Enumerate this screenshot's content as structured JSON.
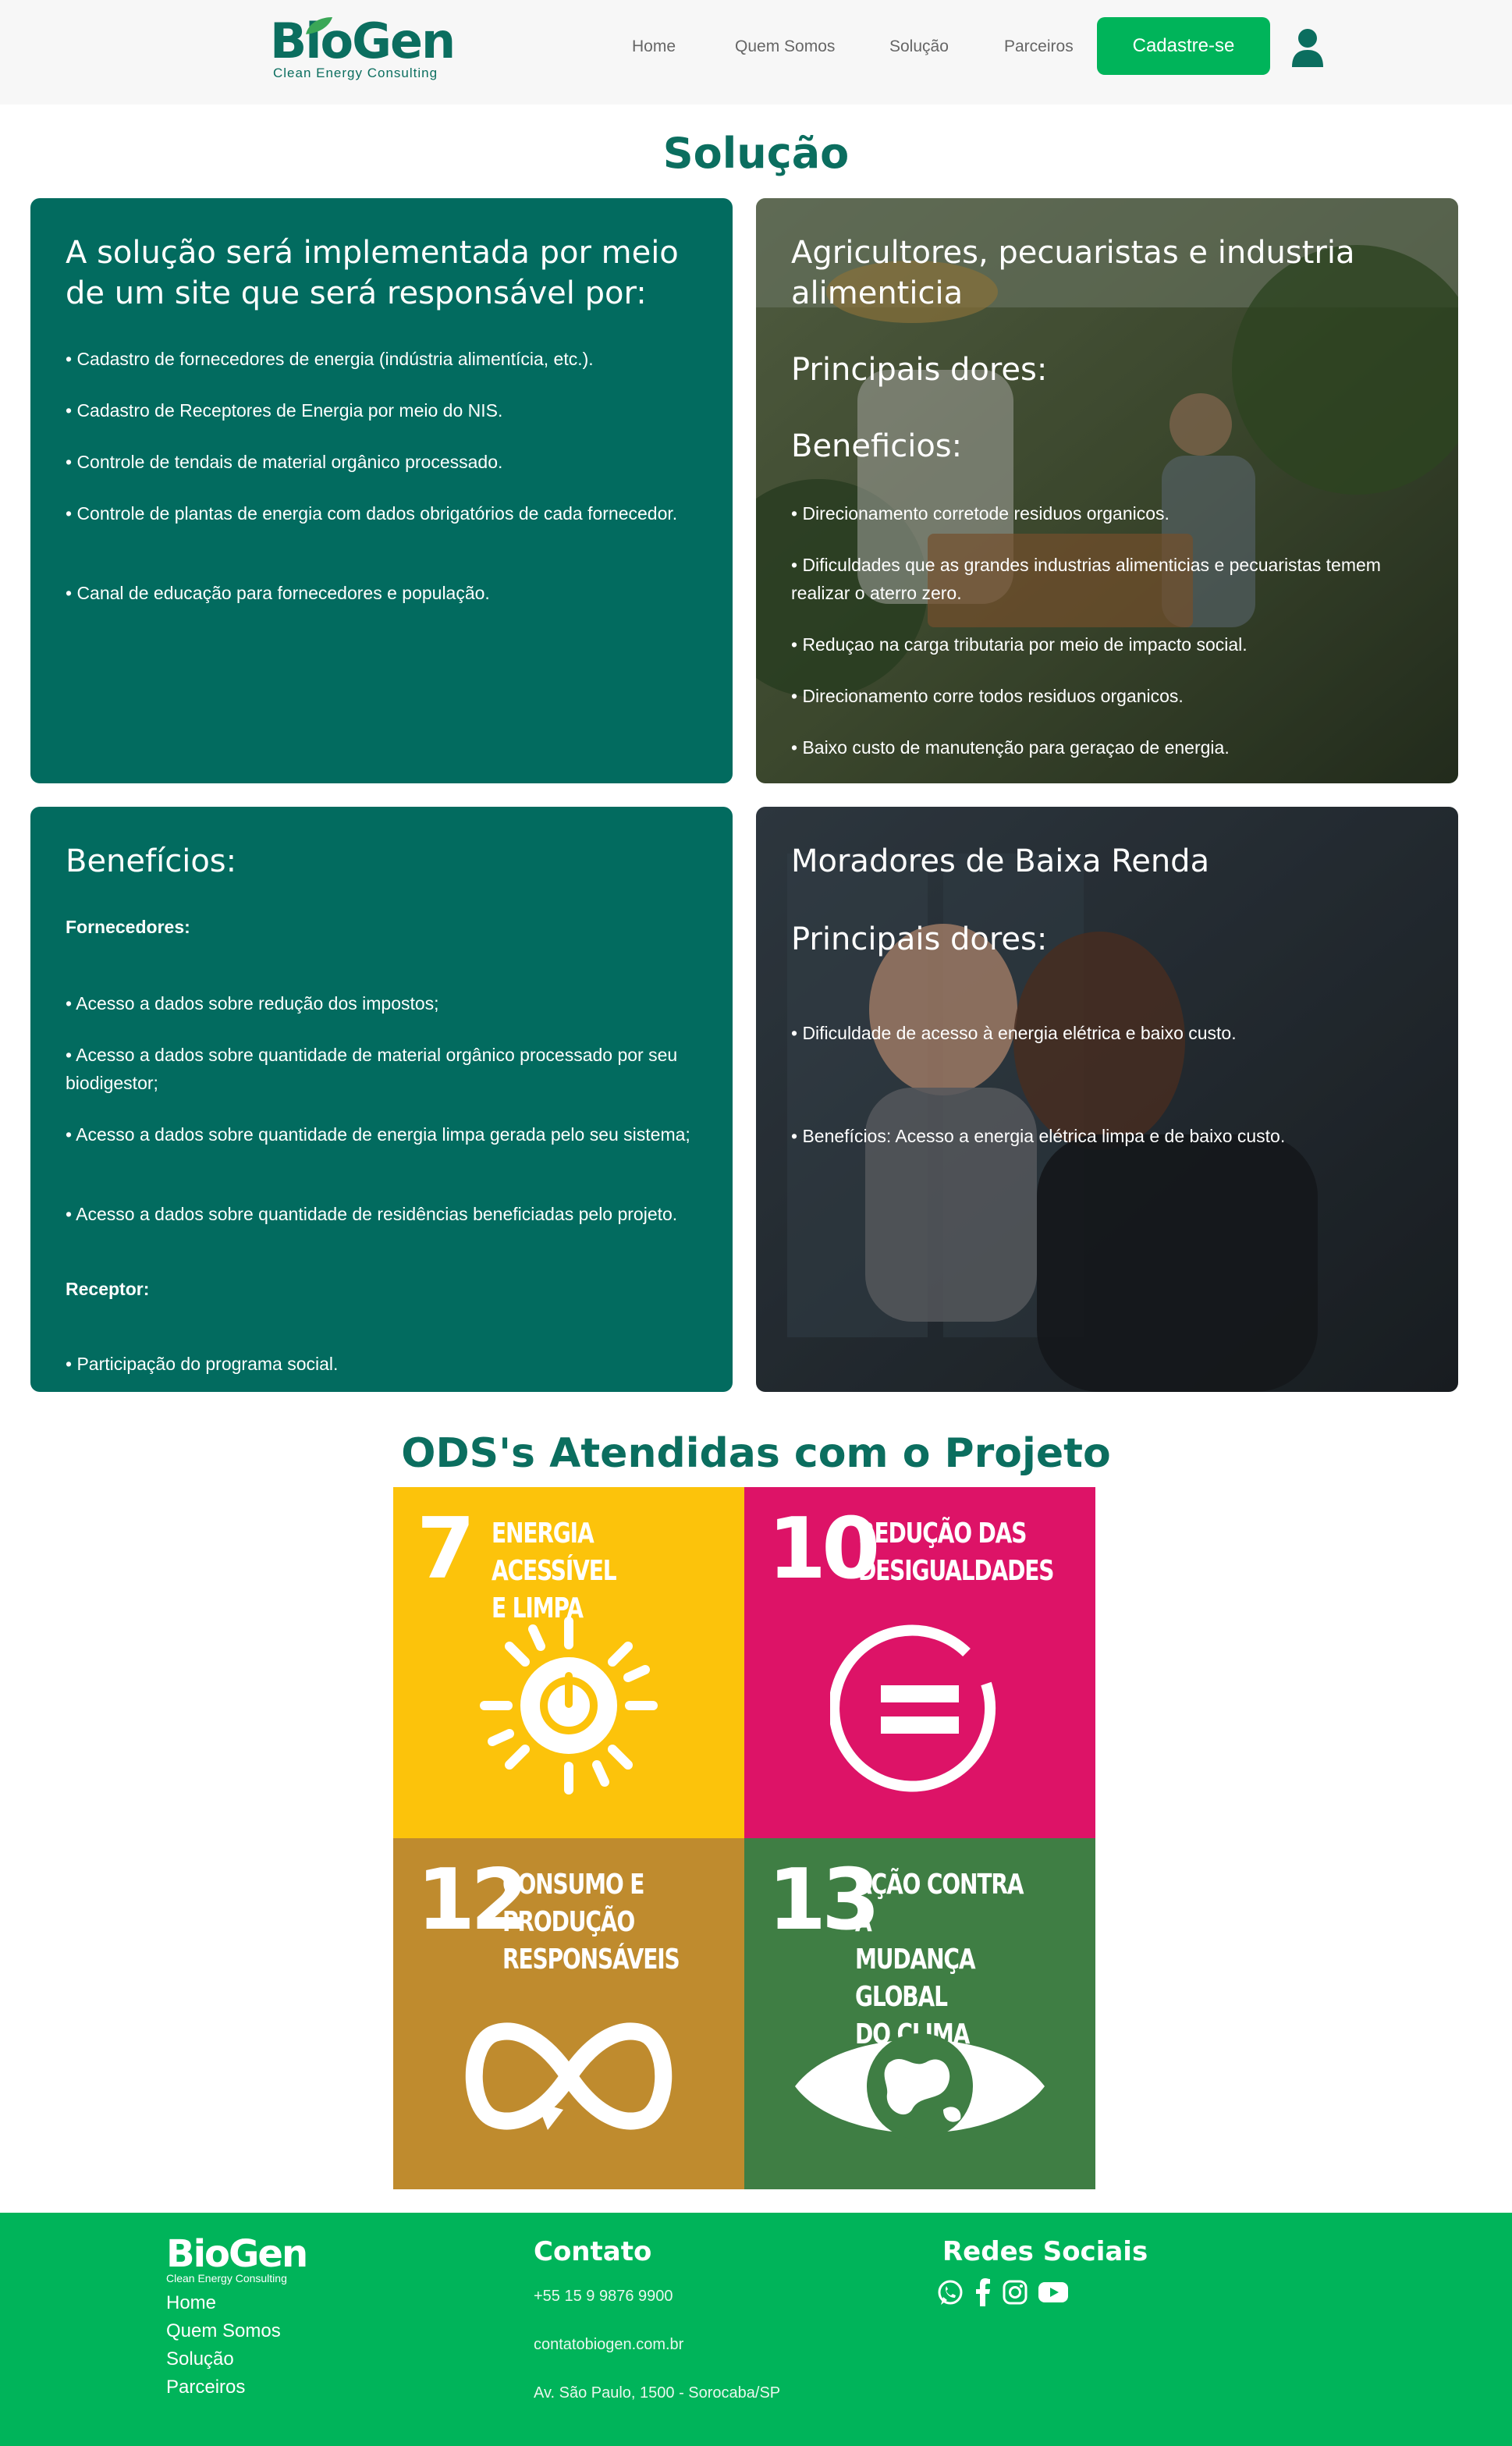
{
  "header": {
    "logo_word": "BioGen",
    "logo_tagline": "Clean Energy Consulting",
    "nav": [
      "Home",
      "Quem Somos",
      "Solução",
      "Parceiros"
    ],
    "cta_label": "Cadastre-se",
    "user_icon": "user-icon"
  },
  "solucao": {
    "title": "Solução",
    "card1": {
      "heading": "A solução será implementada por meio de um site que será responsável por:",
      "items": [
        "• Cadastro de fornecedores de energia (indústria alimentícia, etc.).",
        "• Cadastro de Receptores de Energia por meio do NIS.",
        "• Controle de tendais de material orgânico processado.",
        "• Controle de plantas de energia com dados obrigatórios de cada fornecedor.",
        "• Canal de educação para fornecedores e população."
      ]
    },
    "card2": {
      "heading": "Agricultores, pecuaristas e industria alimenticia",
      "sub1": "Principais dores:",
      "sub2": "Beneficios:",
      "items": [
        "• Direcionamento corretode residuos organicos.",
        "• Dificuldades que as grandes industrias alimenticias e pecuaristas temem realizar o aterro zero.",
        "• Reduçao na carga tributaria por meio de impacto social.",
        "• Direcionamento corre todos residuos organicos.",
        "• Baixo custo de manutenção para geraçao de energia."
      ]
    },
    "card3": {
      "heading": "Benefícios:",
      "fornecedores_label": "Fornecedores:",
      "items": [
        "• Acesso a dados sobre redução dos impostos;",
        "• Acesso a dados sobre quantidade de material orgânico processado por seu biodigestor;",
        "• Acesso a dados sobre quantidade de energia limpa gerada pelo seu sistema;",
        "• Acesso a dados sobre quantidade de residências beneficiadas pelo projeto."
      ],
      "receptor_label": "Receptor:",
      "receptor_item": "• Participação do programa social."
    },
    "card4": {
      "heading": "Moradores de Baixa Renda",
      "sub1": "Principais dores:",
      "item1": "• Dificuldade de acesso à energia elétrica e baixo custo.",
      "item2": "• Benefícios: Acesso a energia elétrica limpa e de baixo custo."
    }
  },
  "ods": {
    "title": "ODS's Atendidas com o Projeto",
    "tiles": [
      {
        "number": "7",
        "label": "ENERGIA ACESSÍVEL\nE LIMPA",
        "color": "#fcc30b",
        "icon": "sun-power-icon"
      },
      {
        "number": "10",
        "label": "REDUÇÃO DAS\nDESIGUALDADES",
        "color": "#dd1367",
        "icon": "equality-circle-icon"
      },
      {
        "number": "12",
        "label": "CONSUMO E\nPRODUÇÃO\nRESPONSÁVEIS",
        "color": "#bf8b2e",
        "icon": "infinity-icon"
      },
      {
        "number": "13",
        "label": "AÇÃO CONTRA A\nMUDANÇA GLOBAL\nDO CLIMA",
        "color": "#3f7e44",
        "icon": "earth-eye-icon"
      }
    ]
  },
  "footer": {
    "logo_word": "BioGen",
    "logo_tagline": "Clean Energy Consulting",
    "links": [
      "Home",
      "Quem Somos",
      "Solução",
      "Parceiros"
    ],
    "contato_title": "Contato",
    "phone": "+55 15 9 9876 9900",
    "email": "contatobiogen.com.br",
    "address": "Av. São Paulo, 1500 - Sorocaba/SP",
    "redes_title": "Redes Sociais",
    "social_icons": [
      "whatsapp-icon",
      "facebook-icon",
      "instagram-icon",
      "youtube-icon"
    ]
  },
  "colors": {
    "brand_dark": "#0b6e5f",
    "card_green": "#026b5f",
    "accent_green": "#00b45a"
  }
}
